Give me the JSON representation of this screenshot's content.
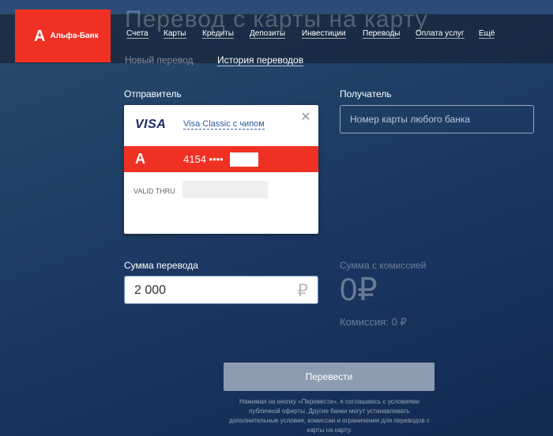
{
  "page": {
    "title": "Перевод с карты на карту"
  },
  "brand": {
    "name": "Альфа-Банк",
    "mark": "А"
  },
  "nav": {
    "items": [
      "Счета",
      "Карты",
      "Кредиты",
      "Депозиты",
      "Инвестиции",
      "Переводы",
      "Оплата услуг",
      "Ещё"
    ]
  },
  "subnav": {
    "new_transfer": "Новый перевод",
    "history": "История переводов"
  },
  "sender": {
    "label": "Отправитель",
    "card_brand": "VISA",
    "card_type": "Visa Classic с чипом",
    "card_number": "4154 ••••",
    "valid_label": "VALID THRU",
    "close_icon": "close-icon"
  },
  "recipient": {
    "label": "Получатель",
    "placeholder": "Номер карты любого банка"
  },
  "amount": {
    "label": "Сумма перевода",
    "value": "2 000",
    "currency": "₽"
  },
  "commission": {
    "title": "Сумма с комиссией",
    "total": "0₽",
    "fee_line": "Комиссия: 0 ₽"
  },
  "submit": {
    "label": "Перевести"
  },
  "disclaimer": "Нажимая на кнопку «Перевести», я соглашаюсь с условиями публичной оферты. Другие банки могут устанавливать дополнительные условия, комиссии и ограничения для переводов с карты на карту.",
  "colors": {
    "brand_red": "#ef3124",
    "background": "#1f3f66"
  }
}
